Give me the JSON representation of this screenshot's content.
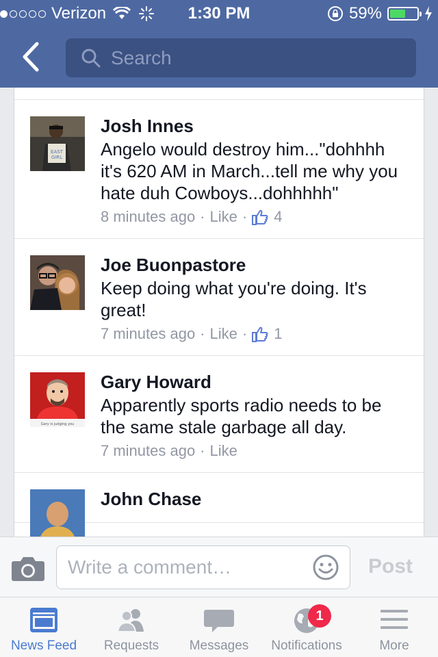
{
  "status_bar": {
    "carrier": "Verizon",
    "time": "1:30 PM",
    "battery": "59%",
    "battery_level": 0.59,
    "signal_bars_filled": 1
  },
  "nav": {
    "back_icon": "chevron-left-icon",
    "search_placeholder": "Search"
  },
  "comments": [
    {
      "author": "Josh Innes",
      "text": "Angelo would destroy him...\"dohhhh it's 620 AM in March...tell me why you hate duh Cowboys...dohhhhh\"",
      "time": "8 minutes ago",
      "like_label": "Like",
      "likes": "4"
    },
    {
      "author": "Joe Buonpastore",
      "text": "Keep doing what you're doing. It's great!",
      "time": "7 minutes ago",
      "like_label": "Like",
      "likes": "1"
    },
    {
      "author": "Gary Howard",
      "text": "Apparently sports radio needs to be the same stale garbage all day.",
      "time": "7 minutes ago",
      "like_label": "Like"
    },
    {
      "author": "John Chase"
    }
  ],
  "composer": {
    "placeholder": "Write a comment…",
    "post_label": "Post"
  },
  "tabs": [
    {
      "label": "News Feed",
      "icon": "news-feed-icon",
      "active": true
    },
    {
      "label": "Requests",
      "icon": "friends-icon"
    },
    {
      "label": "Messages",
      "icon": "messages-icon"
    },
    {
      "label": "Notifications",
      "icon": "globe-icon",
      "badge": "1"
    },
    {
      "label": "More",
      "icon": "menu-icon"
    }
  ],
  "colors": {
    "header_bg": "#4e69a2",
    "search_bg": "#3b5182",
    "active_tab": "#4a7bd0",
    "badge": "#f02849",
    "battery_fill": "#4cd964"
  }
}
